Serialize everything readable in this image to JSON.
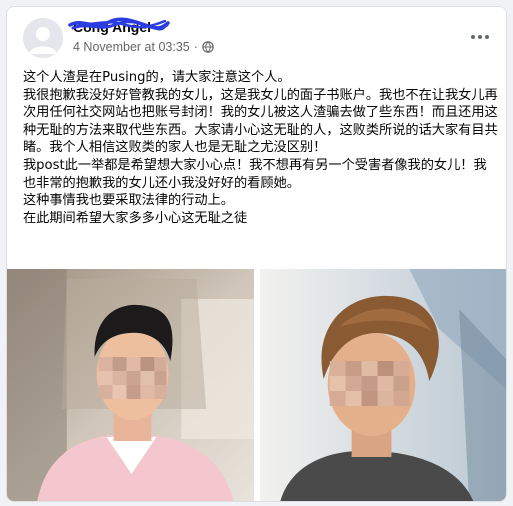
{
  "post": {
    "author": "Cong Angel",
    "timestamp": "4 November at 03:35",
    "privacy_icon": "globe-icon",
    "more_icon": "more-options-icon",
    "text": "这个人渣是在Pusing的，请大家注意这个人。\n我很抱歉我没好好管教我的女儿，这是我女儿的面子书账户。我也不在让我女儿再次用任何社交网站也把账号封闭！我的女儿被这人渣骗去做了些东西！而且还用这种无耻的方法来取代些东西。大家请小心这无耻的人，这败类所说的话大家有目共睹。我个人相信这败类的家人也是无耻之尤没区别！\n我post此一举都是希望想大家小心点！我不想再有另一个受害者像我的女儿！我也非常的抱歉我的女儿还小我没好好的看顾她。\n这种事情我也要采取法律的行动上。\n在此期间希望大家多多小心这无耻之徒"
  },
  "photos": [
    {
      "name": "photo-left",
      "subject": "young man in car, face blurred"
    },
    {
      "name": "photo-right",
      "subject": "young man selfie, face blurred"
    }
  ],
  "colors": {
    "background": "#f0f2f5",
    "card": "#ffffff",
    "text_primary": "#050505",
    "text_secondary": "#65676b",
    "scribble": "#2b3de0"
  }
}
